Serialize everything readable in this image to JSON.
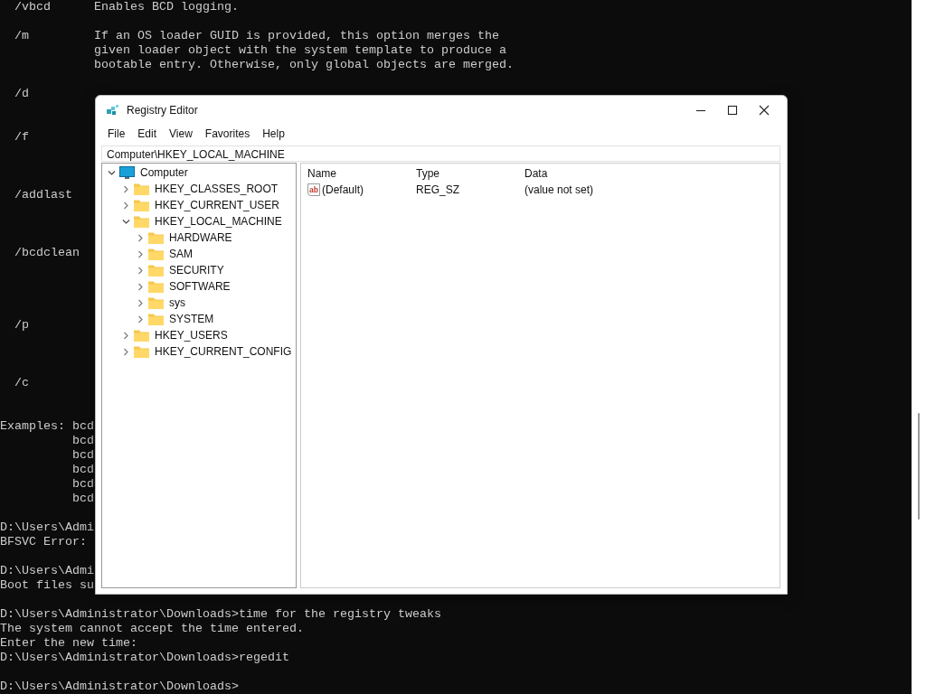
{
  "console": {
    "lines": [
      {
        "kind": "option",
        "switch": "/vbcd",
        "text": "Enables BCD logging."
      },
      {
        "kind": "blank"
      },
      {
        "kind": "option",
        "switch": "/m",
        "text": "If an OS loader GUID is provided, this option merges the"
      },
      {
        "kind": "desc",
        "text": "given loader object with the system template to produce a"
      },
      {
        "kind": "desc",
        "text": "bootable entry. Otherwise, only global objects are merged."
      },
      {
        "kind": "blank"
      },
      {
        "kind": "option",
        "switch": "/d"
      },
      {
        "kind": "blank"
      },
      {
        "kind": "blank"
      },
      {
        "kind": "option",
        "switch": "/f"
      },
      {
        "kind": "blank"
      },
      {
        "kind": "blank"
      },
      {
        "kind": "blank"
      },
      {
        "kind": "option",
        "switch": "/addlast"
      },
      {
        "kind": "blank"
      },
      {
        "kind": "blank"
      },
      {
        "kind": "blank"
      },
      {
        "kind": "option",
        "switch": "/bcdclean"
      },
      {
        "kind": "blank"
      },
      {
        "kind": "blank"
      },
      {
        "kind": "blank"
      },
      {
        "kind": "blank"
      },
      {
        "kind": "option",
        "switch": "/p"
      },
      {
        "kind": "blank"
      },
      {
        "kind": "blank"
      },
      {
        "kind": "blank"
      },
      {
        "kind": "option",
        "switch": "/c"
      },
      {
        "kind": "blank"
      },
      {
        "kind": "blank"
      },
      {
        "kind": "text",
        "text": "Examples: bcd"
      },
      {
        "kind": "example",
        "text": "bcd"
      },
      {
        "kind": "example",
        "text": "bcd"
      },
      {
        "kind": "example",
        "text": "bcd"
      },
      {
        "kind": "example",
        "text": "bcd"
      },
      {
        "kind": "example",
        "text": "bcd"
      },
      {
        "kind": "blank"
      },
      {
        "kind": "text",
        "text": "D:\\Users\\Admi"
      },
      {
        "kind": "text",
        "text": "BFSVC Error:"
      },
      {
        "kind": "blank"
      },
      {
        "kind": "text",
        "text": "D:\\Users\\Admi"
      },
      {
        "kind": "text",
        "text": "Boot files su"
      },
      {
        "kind": "blank"
      },
      {
        "kind": "text",
        "text": "D:\\Users\\Administrator\\Downloads>time for the registry tweaks"
      },
      {
        "kind": "text",
        "text": "The system cannot accept the time entered."
      },
      {
        "kind": "text",
        "text": "Enter the new time:"
      },
      {
        "kind": "text",
        "text": "D:\\Users\\Administrator\\Downloads>regedit"
      },
      {
        "kind": "blank"
      },
      {
        "kind": "text",
        "text": "D:\\Users\\Administrator\\Downloads>"
      }
    ]
  },
  "window": {
    "title": "Registry Editor",
    "menu": [
      "File",
      "Edit",
      "View",
      "Favorites",
      "Help"
    ],
    "address": "Computer\\HKEY_LOCAL_MACHINE",
    "tree": [
      {
        "label": "Computer",
        "expanded": true,
        "children": [
          {
            "label": "HKEY_CLASSES_ROOT",
            "expanded": false
          },
          {
            "label": "HKEY_CURRENT_USER",
            "expanded": false
          },
          {
            "label": "HKEY_LOCAL_MACHINE",
            "expanded": true,
            "children": [
              {
                "label": "HARDWARE",
                "expanded": false
              },
              {
                "label": "SAM",
                "expanded": false
              },
              {
                "label": "SECURITY",
                "expanded": false
              },
              {
                "label": "SOFTWARE",
                "expanded": false
              },
              {
                "label": "sys",
                "expanded": false
              },
              {
                "label": "SYSTEM",
                "expanded": false
              }
            ]
          },
          {
            "label": "HKEY_USERS",
            "expanded": false
          },
          {
            "label": "HKEY_CURRENT_CONFIG",
            "expanded": false
          }
        ]
      }
    ],
    "table": {
      "columns": [
        "Name",
        "Type",
        "Data"
      ],
      "rows": [
        {
          "icon_text": "ab",
          "name": "(Default)",
          "type": "REG_SZ",
          "data": "(value not set)"
        }
      ]
    }
  }
}
